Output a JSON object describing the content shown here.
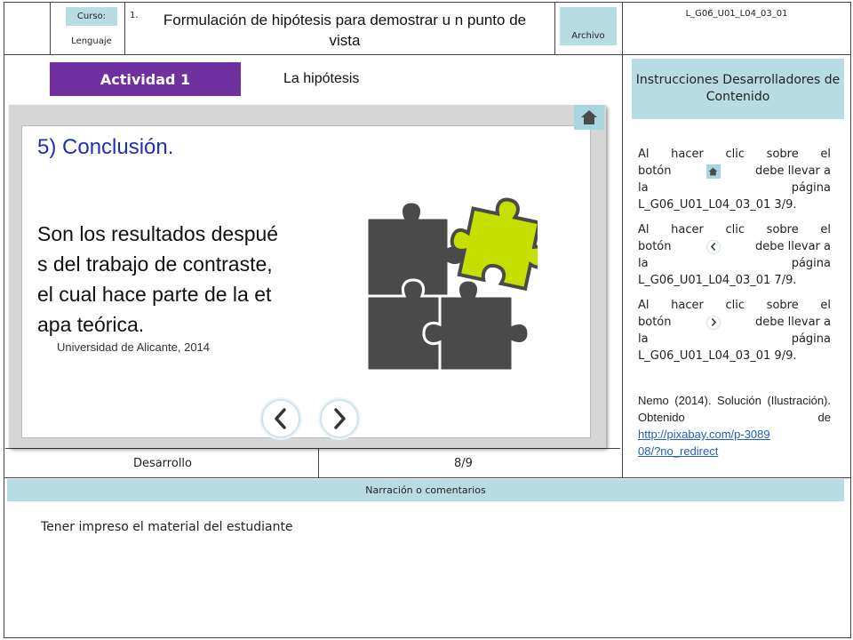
{
  "header": {
    "curso_label": "Curso:",
    "curso_value": "1.",
    "lenguaje_label": "Lenguaje",
    "title": "Formulación de hipótesis para demostrar u n punto de vista",
    "archivo_label": "Archivo",
    "code": "L_G06_U01_L04_03_01"
  },
  "activity": {
    "label": "Actividad 1",
    "subtitle": "La hipótesis"
  },
  "slide": {
    "heading": "5) Conclusión.",
    "body_lines": [
      "Son los resultados despué",
      "s del trabajo de contraste,",
      "el cual hace parte de la et",
      "apa teórica."
    ],
    "citation": "Universidad de Alicante, 2014"
  },
  "instructions": {
    "header": "Instrucciones Desarrolladores de Contenido",
    "items": [
      {
        "l1a": "Al",
        "l1b": "hacer",
        "l1c": "clic",
        "l1d": "sobre",
        "l1e": "el",
        "l2a": "botón",
        "l2b": "debe llevar a",
        "l3a": "la",
        "l3b": "página",
        "l4": "L_G06_U01_L04_03_01 3/9.",
        "icon": "home-icon"
      },
      {
        "l1a": "Al",
        "l1b": "hacer",
        "l1c": "clic",
        "l1d": "sobre",
        "l1e": "el",
        "l2a": "botón",
        "l2b": "debe llevar a",
        "l3a": "la",
        "l3b": "página",
        "l4": "L_G06_U01_L04_03_01 7/9.",
        "icon": "chevron-left-icon"
      },
      {
        "l1a": "Al",
        "l1b": "hacer",
        "l1c": "clic",
        "l1d": "sobre",
        "l1e": "el",
        "l2a": "botón",
        "l2b": "debe llevar a",
        "l3a": "la",
        "l3b": "página",
        "l4": "L_G06_U01_L04_03_01 9/9.",
        "icon": "chevron-right-icon"
      }
    ],
    "credit_text": "Nemo (2014). Solución (Ilustración). Obtenido de",
    "credit_link": "http://pixabay.com/p-308908/?no_redirect"
  },
  "footer": {
    "section": "Desarrollo",
    "page": "8/9",
    "narration_label": "Narración o comentarios",
    "narration_text": "Tener impreso el material del estudiante"
  },
  "colors": {
    "activity": "#7030a0",
    "accent_light": "#b7dde3",
    "heading_blue": "#1f2fb8",
    "puzzle_dark": "#4a4a4a",
    "puzzle_green": "#c5e000"
  }
}
